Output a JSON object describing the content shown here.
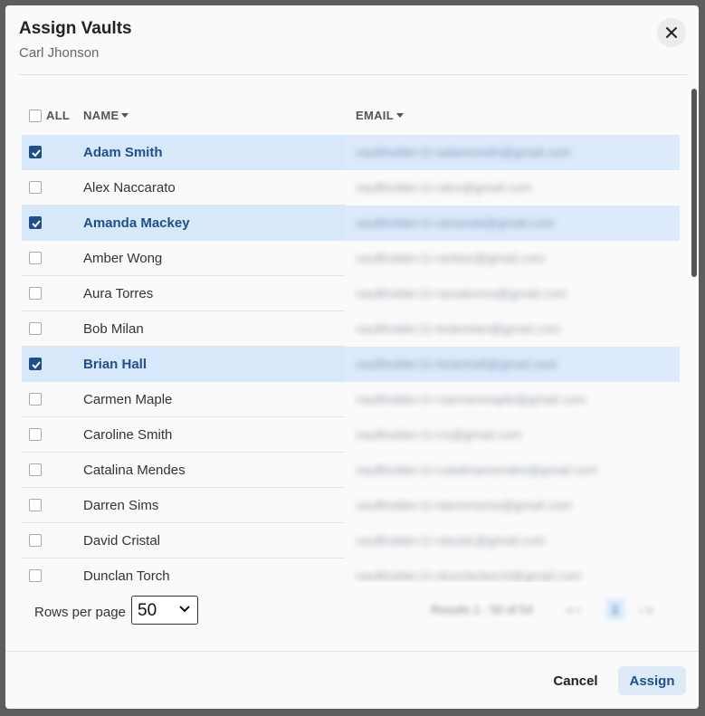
{
  "dialog": {
    "title": "Assign Vaults",
    "subtitle": "Carl Jhonson"
  },
  "table": {
    "columns": {
      "all": "ALL",
      "name": "NAME",
      "email": "EMAIL"
    },
    "rows": [
      {
        "name": "Adam Smith",
        "email": "vaultholder.t1+adamsmith@gmail.com",
        "checked": true
      },
      {
        "name": "Alex Naccarato",
        "email": "vaultholder.t1+alex@gmail.com",
        "checked": false
      },
      {
        "name": "Amanda Mackey",
        "email": "vaultholder.t1+amanda@gmail.com",
        "checked": true
      },
      {
        "name": "Amber Wong",
        "email": "vaultholder.t1+amber@gmail.com",
        "checked": false
      },
      {
        "name": "Aura Torres",
        "email": "vaultholder.t1+auratorres@gmail.com",
        "checked": false
      },
      {
        "name": "Bob Milan",
        "email": "vaultholder.t1+bobmilan@gmail.com",
        "checked": false
      },
      {
        "name": "Brian Hall",
        "email": "vaultholder.t1+brianhall@gmail.com",
        "checked": true
      },
      {
        "name": "Carmen Maple",
        "email": "vaultholder.t1+carmenmaple@gmail.com",
        "checked": false
      },
      {
        "name": "Caroline Smith",
        "email": "vaultholder.t1+cs@gmail.com",
        "checked": false
      },
      {
        "name": "Catalina Mendes",
        "email": "vaultholder.t1+catalinamendes@gmail.com",
        "checked": false
      },
      {
        "name": "Darren Sims",
        "email": "vaultholder.t1+darrensims@gmail.com",
        "checked": false
      },
      {
        "name": "David Cristal",
        "email": "vaultholder.t1+davidc@gmail.com",
        "checked": false
      },
      {
        "name": "Dunclan Torch",
        "email": "vaultholder.t1+dunclantorch@gmail.com",
        "checked": false
      }
    ]
  },
  "pagination": {
    "rows_per_page_label": "Rows per page",
    "rows_per_page_value": "50",
    "range_text": "Results 1 - 50 of 54",
    "prev": "«  ‹",
    "current_page": "1",
    "next": "›  »"
  },
  "actions": {
    "cancel": "Cancel",
    "assign": "Assign"
  },
  "colors": {
    "accent": "#1f4f8b",
    "selected_row": "#d7e8fb",
    "assign_bg": "#ddebf9"
  }
}
